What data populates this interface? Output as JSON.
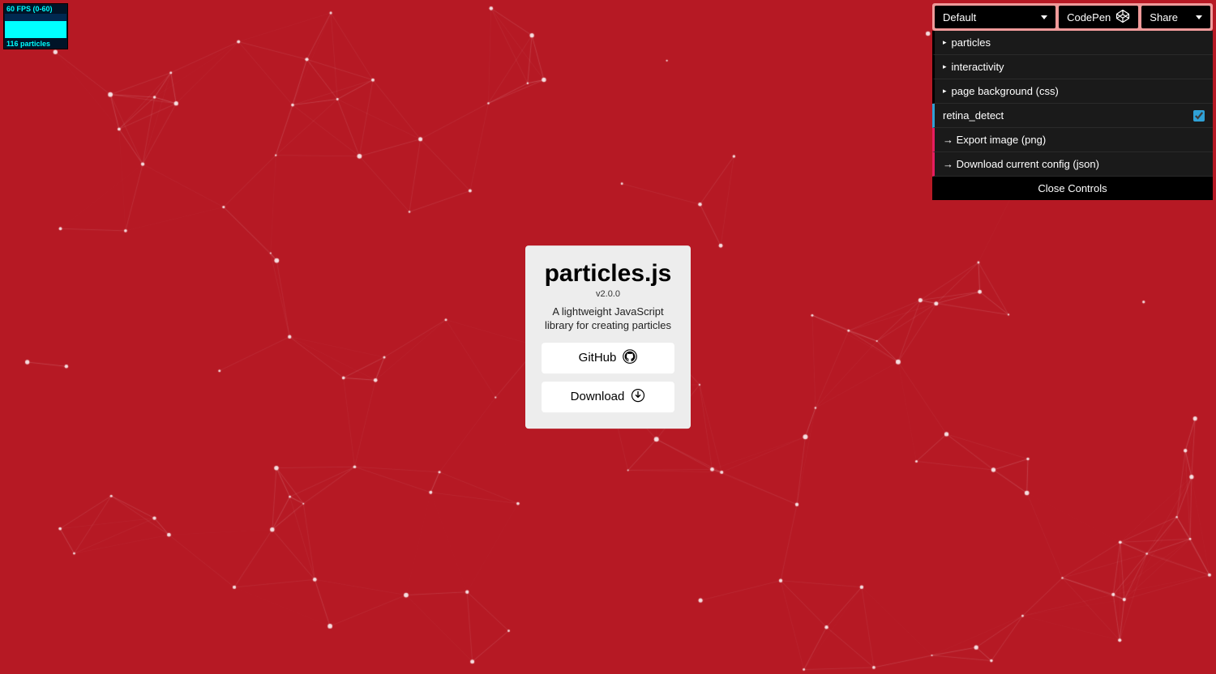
{
  "background_color": "#b61924",
  "stats": {
    "fps_label": "60 FPS (0-60)",
    "particles_label": "116 particles"
  },
  "card": {
    "title": "particles.js",
    "version": "v2.0.0",
    "description": "A lightweight JavaScript library for creating particles",
    "github_label": "GitHub",
    "download_label": "Download"
  },
  "panel": {
    "preset_selected": "Default",
    "codepen_label": "CodePen",
    "share_label": "Share",
    "folders": [
      "particles",
      "interactivity",
      "page background (css)"
    ],
    "retina_label": "retina_detect",
    "retina_checked": true,
    "export_image_label": "→ Export image (png)",
    "download_config_label": "→ Download current config (json)",
    "close_label": "Close Controls"
  }
}
